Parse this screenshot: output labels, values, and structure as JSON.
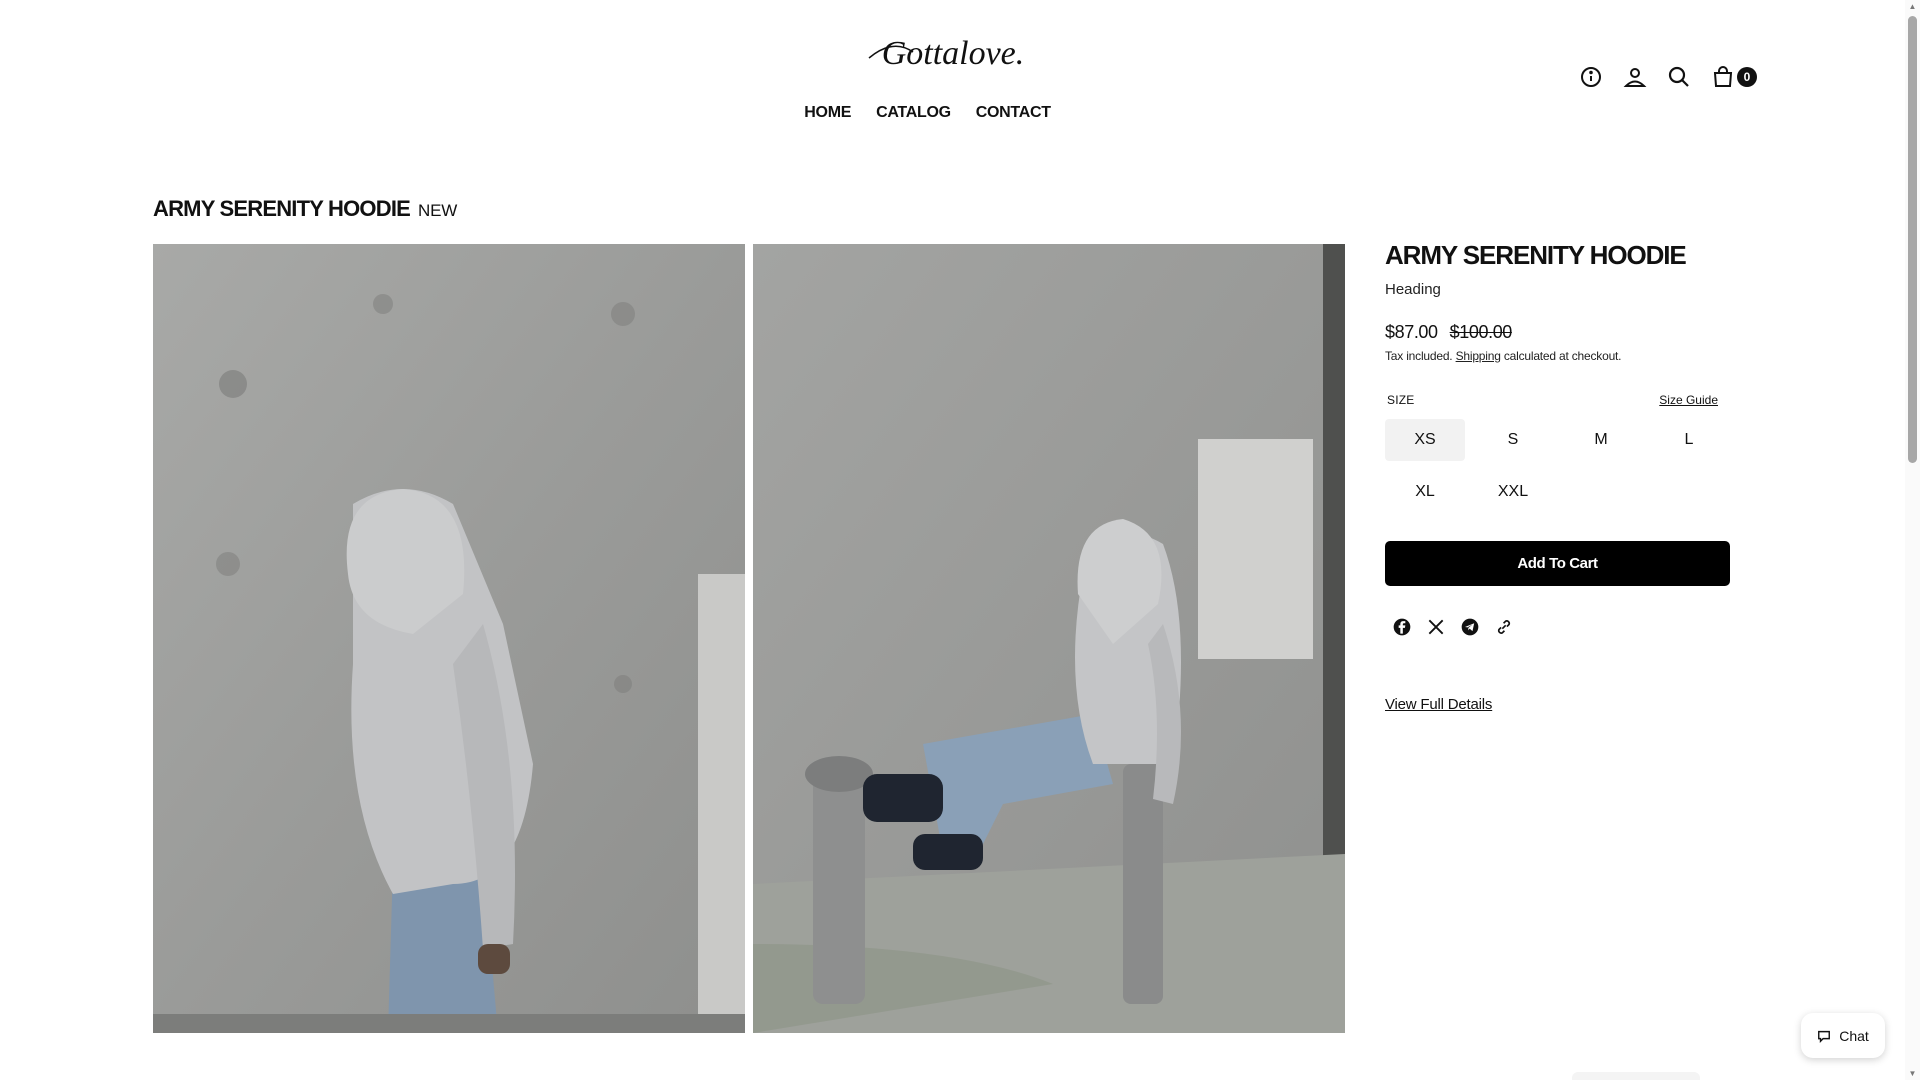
{
  "header": {
    "logo_text": "Gottalove.",
    "nav": [
      "HOME",
      "CATALOG",
      "CONTACT"
    ],
    "cart_count": "0",
    "icons": [
      "info-icon",
      "account-icon",
      "search-icon",
      "cart-icon"
    ]
  },
  "page": {
    "title": "ARMY SERENITY HOODIE",
    "badge": "NEW"
  },
  "product": {
    "title": "ARMY SERENITY HOODIE",
    "subtitle": "Heading",
    "price": "$87.00",
    "compare_price": "$100.00",
    "tax_before": "Tax included.",
    "tax_link": "Shipping",
    "tax_after": "calculated at checkout.",
    "size_label": "SIZE",
    "size_guide": "Size Guide",
    "sizes": [
      "XS",
      "S",
      "M",
      "L",
      "XL",
      "XXL"
    ],
    "selected_size": "XS",
    "add_to_cart": "Add To Cart",
    "share_icons": [
      "facebook-icon",
      "x-icon",
      "telegram-icon",
      "link-icon"
    ],
    "view_details": "View Full Details"
  },
  "chat": {
    "label": "Chat"
  },
  "colors": {
    "accent": "#000000",
    "selected_size_bg": "#f2f2f2"
  }
}
